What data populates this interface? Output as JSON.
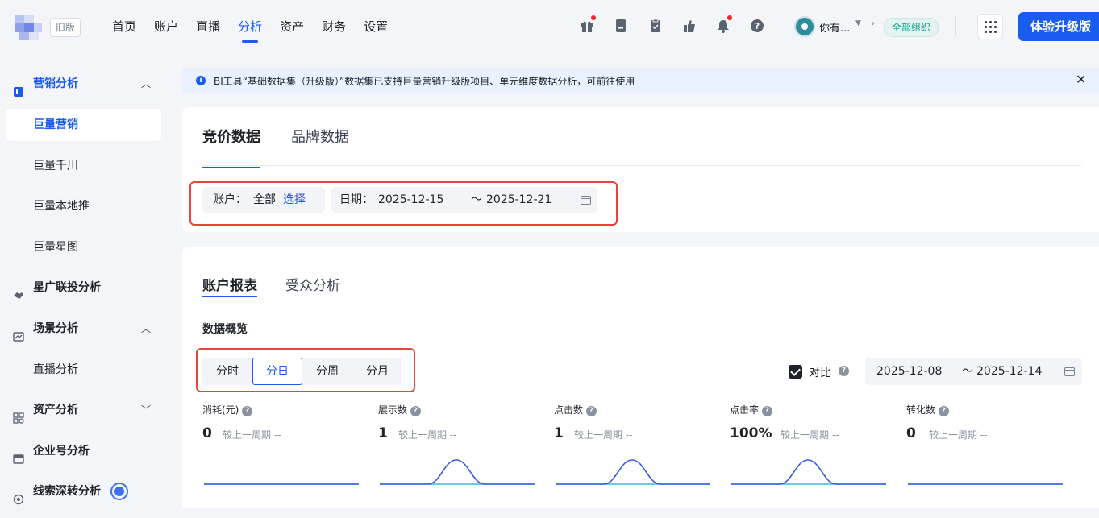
{
  "header": {
    "old_version_label": "旧版",
    "nav": [
      {
        "label": "首页",
        "active": false
      },
      {
        "label": "账户",
        "active": false
      },
      {
        "label": "直播",
        "active": false
      },
      {
        "label": "分析",
        "active": true
      },
      {
        "label": "资产",
        "active": false
      },
      {
        "label": "财务",
        "active": false
      },
      {
        "label": "设置",
        "active": false
      }
    ],
    "icons": [
      "gift-icon",
      "document-icon",
      "clipboard-icon",
      "share-icon",
      "bell-icon",
      "help-icon"
    ],
    "user_name": "你有...",
    "org_label": "全部组织",
    "upgrade_label": "体验升级版",
    "accent": "#1b5cf0"
  },
  "sidebar": {
    "items": [
      {
        "label": "营销分析",
        "icon": "marketing-analysis-icon",
        "expanded": true
      },
      {
        "label": "巨量营销",
        "selected": true
      },
      {
        "label": "巨量千川"
      },
      {
        "label": "巨量本地推"
      },
      {
        "label": "巨量星图"
      },
      {
        "label": "星广联投分析",
        "icon": "handshake-icon"
      },
      {
        "label": "场景分析",
        "icon": "scene-icon",
        "expanded": true
      },
      {
        "label": "直播分析"
      },
      {
        "label": "资产分析",
        "icon": "asset-icon",
        "expanded": false
      },
      {
        "label": "企业号分析",
        "icon": "enterprise-icon"
      },
      {
        "label": "线索深转分析",
        "icon": "lead-icon"
      }
    ]
  },
  "notice": {
    "text": "BI工具“基础数据集（升级版）”数据集已支持巨量营销升级版项目、单元维度数据分析，可前往使用"
  },
  "top_card": {
    "tabs": [
      "竞价数据",
      "品牌数据"
    ],
    "active_tab": "竞价数据",
    "account_label": "账户：",
    "account_value": "全部",
    "account_select": "选择",
    "date_label": "日期：",
    "date_start": "2025-12-15",
    "date_sep": "～",
    "date_end": "2025-12-21"
  },
  "report": {
    "tabs": [
      "账户报表",
      "受众分析"
    ],
    "active_tab": "账户报表",
    "overview_title": "数据概览",
    "granularity": [
      "分时",
      "分日",
      "分周",
      "分月"
    ],
    "granularity_selected": "分日",
    "compare_label": "对比",
    "compare_checked": true,
    "compare_start": "2025-12-08",
    "compare_sep": "～",
    "compare_end": "2025-12-14",
    "metrics": [
      {
        "label": "消耗(元)",
        "value": "0",
        "compare": "较上一周期 --",
        "peak": false
      },
      {
        "label": "展示数",
        "value": "1",
        "compare": "较上一周期 --",
        "peak": true
      },
      {
        "label": "点击数",
        "value": "1",
        "compare": "较上一周期 --",
        "peak": true
      },
      {
        "label": "点击率",
        "value": "100%",
        "compare": "较上一周期 --",
        "peak": true
      },
      {
        "label": "转化数",
        "value": "0",
        "compare": "较上一周期 --",
        "peak": false
      }
    ],
    "spark_colors": {
      "current": "#3b5bdb",
      "baseline": "#33c1d6"
    }
  }
}
